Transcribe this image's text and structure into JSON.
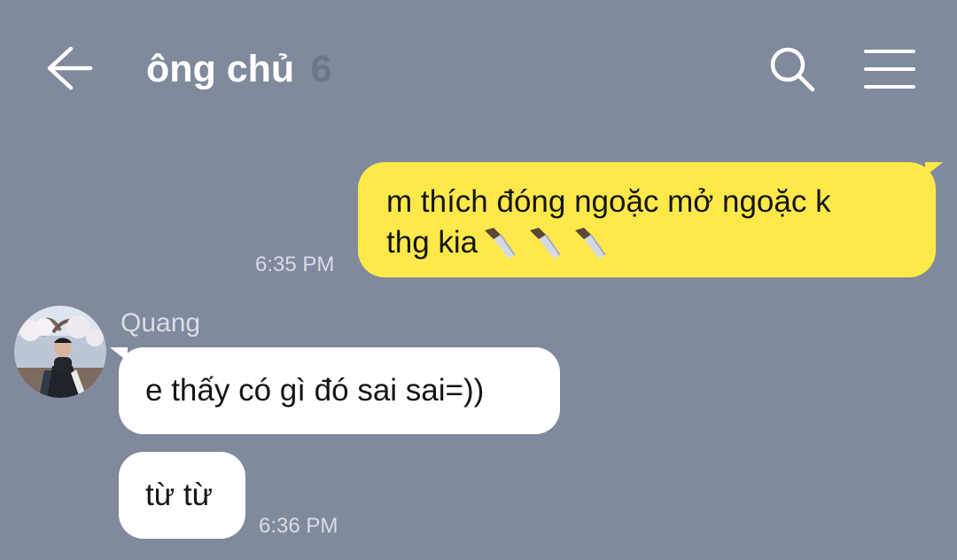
{
  "header": {
    "title": "ông chủ",
    "member_count": "6",
    "icons": [
      "back-arrow-icon",
      "search-icon",
      "menu-icon"
    ]
  },
  "messages": {
    "outgoing": {
      "line1": "m thích đóng ngoặc mở ngoặc k",
      "line2": "thg kia",
      "emoji": "knife-icon ×3",
      "time": "6:35 PM"
    },
    "incoming": {
      "sender": "Quang",
      "message1": "e thấy có gì đó sai sai=))",
      "message2": "từ từ",
      "time": "6:36 PM"
    }
  },
  "colors": {
    "background": "#808a9c",
    "outgoing_bubble": "#ffe94a",
    "incoming_bubble": "#ffffff",
    "title_text": "#ffffff",
    "member_count_text": "#6e7787",
    "meta_text": "#d9dde5"
  }
}
